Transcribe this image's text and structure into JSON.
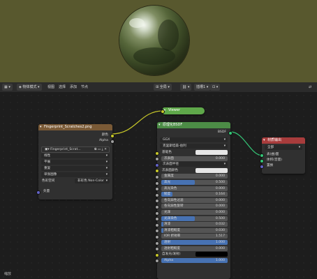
{
  "toolbar": {
    "mode": "物体模式",
    "menus": [
      "视图",
      "选择",
      "添加",
      "节点"
    ],
    "global": "全局",
    "slot": "插槽1"
  },
  "image_node": {
    "title": "Fingerprint_Scratches2.png",
    "out_color": "颜色",
    "out_alpha": "Alpha",
    "image_name": "Fingerprint_Scrat...",
    "interp": "线性",
    "projection": "平展",
    "extension": "重复",
    "source": "单张图像",
    "colorspace_label": "色彩空间",
    "colorspace": "非彩色 Non-Color",
    "in_vector": "矢量"
  },
  "viewer_node": {
    "title": "Viewer"
  },
  "bsdf_node": {
    "title": "原理化BSDF",
    "out": "BSDF",
    "distribution": "GGX",
    "subsurface_method": "克里斯坦森-伯利",
    "rows": [
      {
        "label": "基础色",
        "type": "color",
        "color": "#e6e6e6"
      },
      {
        "label": "次表面",
        "value": "0.000",
        "sock": "#a1a1a1"
      },
      {
        "label": "次表面半径",
        "type": "dropdown",
        "sock": "#6363c7"
      },
      {
        "label": "次表面颜色",
        "type": "color",
        "color": "#e6e6e6"
      },
      {
        "label": "金属度",
        "value": "0.000",
        "sock": "#a1a1a1"
      },
      {
        "label": "高光",
        "value": "0.500",
        "sock": "#a1a1a1",
        "fill": 0.5
      },
      {
        "label": "高光染色",
        "value": "0.000",
        "sock": "#a1a1a1"
      },
      {
        "label": "糙度",
        "value": "0.164",
        "sock": "#a1a1a1",
        "fill": 0.164
      },
      {
        "label": "各向异性过滤",
        "value": "0.000",
        "sock": "#a1a1a1"
      },
      {
        "label": "各向异性旋转",
        "value": "0.000",
        "sock": "#a1a1a1"
      },
      {
        "label": "光泽",
        "value": "0.000",
        "sock": "#a1a1a1"
      },
      {
        "label": "光泽染色",
        "value": "0.500",
        "sock": "#a1a1a1",
        "fill": 0.5
      },
      {
        "label": "清漆",
        "value": "0.032",
        "sock": "#a1a1a1",
        "fill": 0.032
      },
      {
        "label": "清漆粗糙度",
        "value": "0.030",
        "sock": "#a1a1a1",
        "fill": 0.03
      },
      {
        "label": "IOR 折射率",
        "value": "1.517",
        "sock": "#a1a1a1"
      },
      {
        "label": "透射",
        "value": "1.000",
        "sock": "#a1a1a1",
        "fill": 1.0
      },
      {
        "label": "透射粗糙度",
        "value": "0.000",
        "sock": "#a1a1a1"
      },
      {
        "label": "自发光(发射)",
        "type": "color",
        "color": "#000000"
      },
      {
        "label": "Alpha",
        "value": "1.000",
        "sock": "#a1a1a1",
        "fill": 1.0
      }
    ]
  },
  "output_node": {
    "title": "材质输出",
    "target": "全部",
    "in_surface": "表(曲)面",
    "in_volume": "体积(音量)",
    "in_disp": "置换"
  },
  "status": "缩放"
}
